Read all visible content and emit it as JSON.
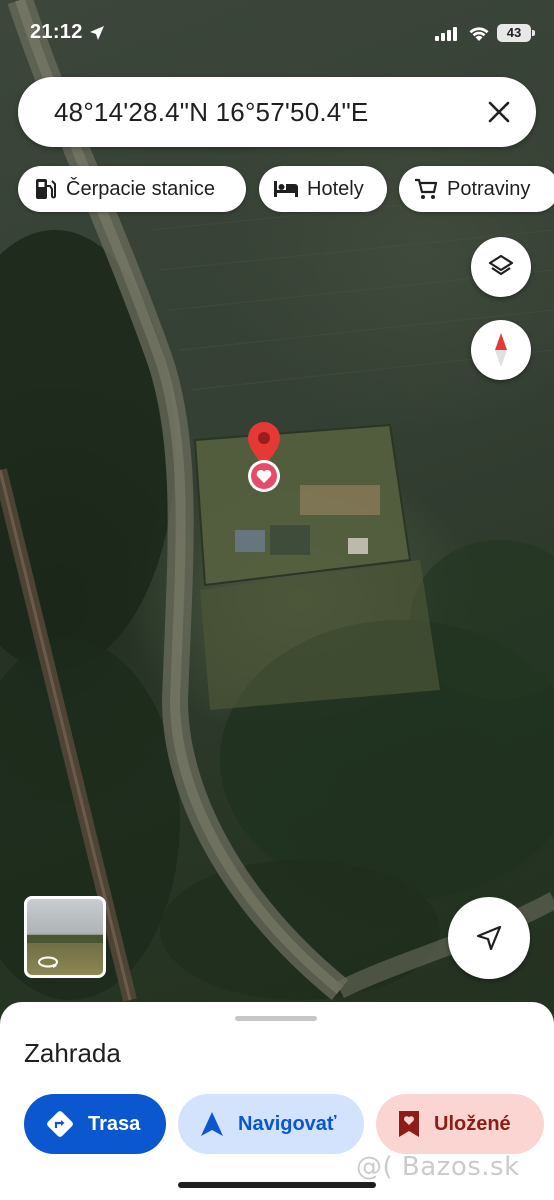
{
  "status_bar": {
    "time": "21:12",
    "battery": "43"
  },
  "search": {
    "query": "48°14'28.4\"N 16°57'50.4\"E"
  },
  "chips": [
    {
      "label": "Čerpacie stanice",
      "icon": "gas-station-icon"
    },
    {
      "label": "Hotely",
      "icon": "bed-icon"
    },
    {
      "label": "Potraviny",
      "icon": "cart-icon"
    }
  ],
  "place": {
    "title": "Zahrada"
  },
  "actions": {
    "route_label": "Trasa",
    "navigate_label": "Navigovať",
    "saved_label": "Uložené"
  },
  "colors": {
    "primary_blue": "#0b57d0",
    "light_blue": "#d3e3fd",
    "saved_bg": "#fbd5d2",
    "saved_fg": "#8c1d18",
    "pin_red": "#e53935"
  },
  "watermark": "@( Bazos.sk"
}
